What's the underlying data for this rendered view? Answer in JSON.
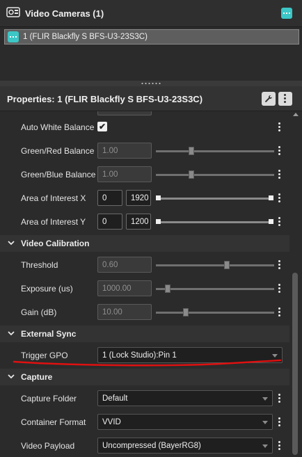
{
  "cameras_panel": {
    "title": "Video Cameras (1)",
    "camera_items": [
      {
        "label": "1 (FLIR Blackfly S BFS-U3-23S3C)"
      }
    ]
  },
  "properties_panel": {
    "title": "Properties: 1 (FLIR Blackfly S BFS-U3-23S3C)",
    "rows": {
      "auto_white_balance": {
        "label": "Auto White Balance",
        "checked": true,
        "check_glyph": "✔"
      },
      "green_red_balance": {
        "label": "Green/Red Balance",
        "value": "1.00",
        "level": 0.3
      },
      "green_blue_balance": {
        "label": "Green/Blue Balance",
        "value": "1.00",
        "level": 0.3
      },
      "aoi_x": {
        "label": "Area of Interest X",
        "min": "0",
        "max": "1920"
      },
      "aoi_y": {
        "label": "Area of Interest Y",
        "min": "0",
        "max": "1200"
      },
      "threshold": {
        "label": "Threshold",
        "value": "0.60",
        "level": 0.6
      },
      "exposure": {
        "label": "Exposure (us)",
        "value": "1000.00",
        "level": 0.1
      },
      "gain": {
        "label": "Gain (dB)",
        "value": "10.00",
        "level": 0.25
      },
      "trigger_gpo": {
        "label": "Trigger GPO",
        "value": "1 (Lock Studio):Pin 1"
      },
      "capture_folder": {
        "label": "Capture Folder",
        "value": "Default"
      },
      "container_format": {
        "label": "Container Format",
        "value": "VVID"
      },
      "video_payload": {
        "label": "Video Payload",
        "value": "Uncompressed (BayerRG8)"
      }
    },
    "sections": {
      "video_calibration": "Video Calibration",
      "external_sync": "External Sync",
      "capture": "Capture"
    }
  },
  "colors": {
    "accent_teal": "#3cc6c6",
    "annotation_red": "#e01010",
    "panel_bg": "#2b2b2b"
  }
}
